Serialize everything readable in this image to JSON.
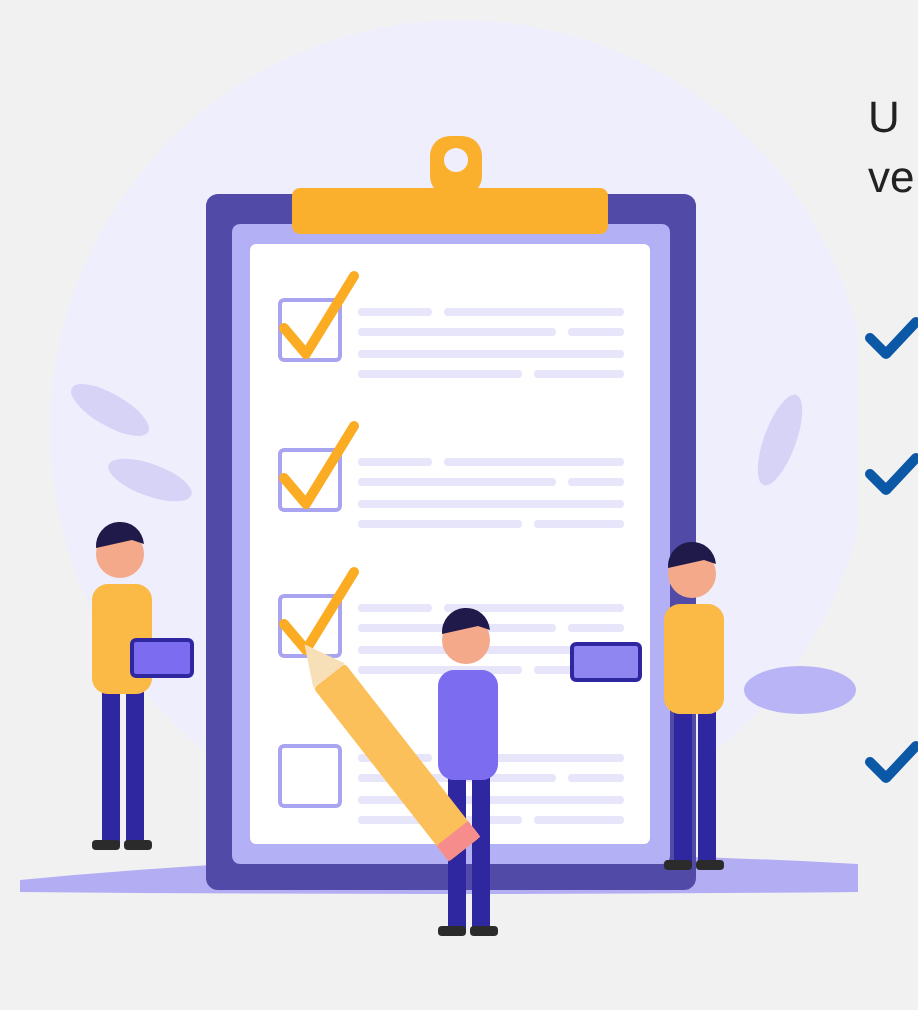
{
  "illustration": {
    "checklist": [
      {
        "checked": true
      },
      {
        "checked": true
      },
      {
        "checked": true
      },
      {
        "checked": false
      }
    ]
  },
  "intro": {
    "lines": [
      "U",
      "ve"
    ]
  },
  "bullets": [
    {
      "kind": "check"
    },
    {
      "kind": "check"
    },
    {
      "kind": "check"
    }
  ]
}
